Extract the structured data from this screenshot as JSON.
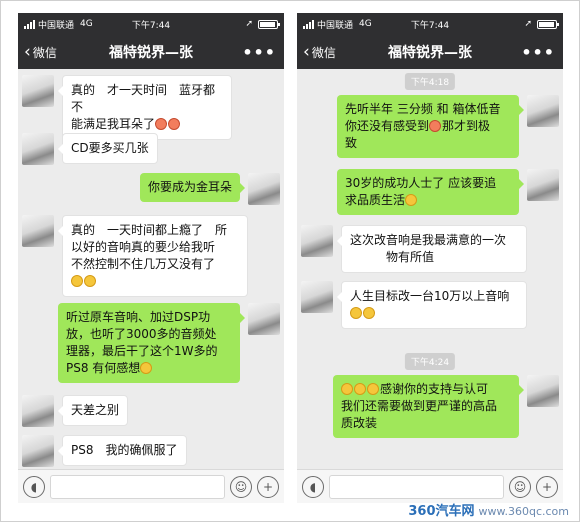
{
  "status": {
    "carrier": "中国联通",
    "network": "4G",
    "time": "下午7:44"
  },
  "nav": {
    "back": "微信",
    "title": "福特锐界—张",
    "more": "•••"
  },
  "left_phone": {
    "messages": [
      {
        "side": "l",
        "text_lines": [
          "真的　才一天时间　蓝牙都不",
          "能满足我耳朵了"
        ],
        "emoji": [
          "red",
          "red"
        ]
      },
      {
        "side": "l",
        "text_lines": [
          "CD要多买几张"
        ]
      },
      {
        "side": "r",
        "text_lines": [
          "你要成为金耳朵"
        ]
      },
      {
        "side": "l",
        "text_lines": [
          "真的　一天时间都上瘾了　所",
          "以好的音响真的要少给我听",
          "不然控制不住几万又没有了"
        ],
        "emoji": [
          "yellow",
          "yellow"
        ]
      },
      {
        "side": "r",
        "text_lines": [
          "听过原车音响、加过DSP功",
          "放，也听了3000多的音频处",
          "理器，最后干了这个1W多的",
          "PS8  有何感想"
        ],
        "emoji_inline": [
          "yellow"
        ]
      },
      {
        "side": "l",
        "text_lines": [
          "天差之别"
        ]
      },
      {
        "side": "l",
        "text_lines": [
          "PS8　我的确佩服了"
        ]
      }
    ]
  },
  "right_phone": {
    "timestamps": [
      "下午4:18",
      "下午4:24"
    ],
    "messages": [
      {
        "side": "r",
        "text_lines": [
          "先听半年 三分频 和 箱体低音",
          "你还没有感受到",
          "那才到极",
          "致"
        ],
        "emoji": [
          "red"
        ]
      },
      {
        "side": "r",
        "text_lines": [
          "30岁的成功人士了 应该要追",
          "求品质生活"
        ],
        "emoji": [
          "yellow"
        ]
      },
      {
        "side": "l",
        "text_lines": [
          "这次改音响是我最满意的一次",
          "物有所值"
        ]
      },
      {
        "side": "l",
        "text_lines": [
          "人生目标改一台10万以上音响"
        ],
        "emoji": [
          "yellow",
          "yellow"
        ]
      },
      {
        "side": "r",
        "text_lines": [
          "感谢你的支持与认可",
          "我们还需要做到更严谨的高品",
          "质改装"
        ],
        "emoji": [
          "yellow",
          "yellow",
          "yellow"
        ]
      }
    ]
  },
  "input": {
    "voice_icon": "voice-icon",
    "emoji_icon": "emoji-icon",
    "plus_icon": "plus-icon"
  },
  "watermark": {
    "brand": "360汽车网",
    "site": "www.360qc.com"
  }
}
